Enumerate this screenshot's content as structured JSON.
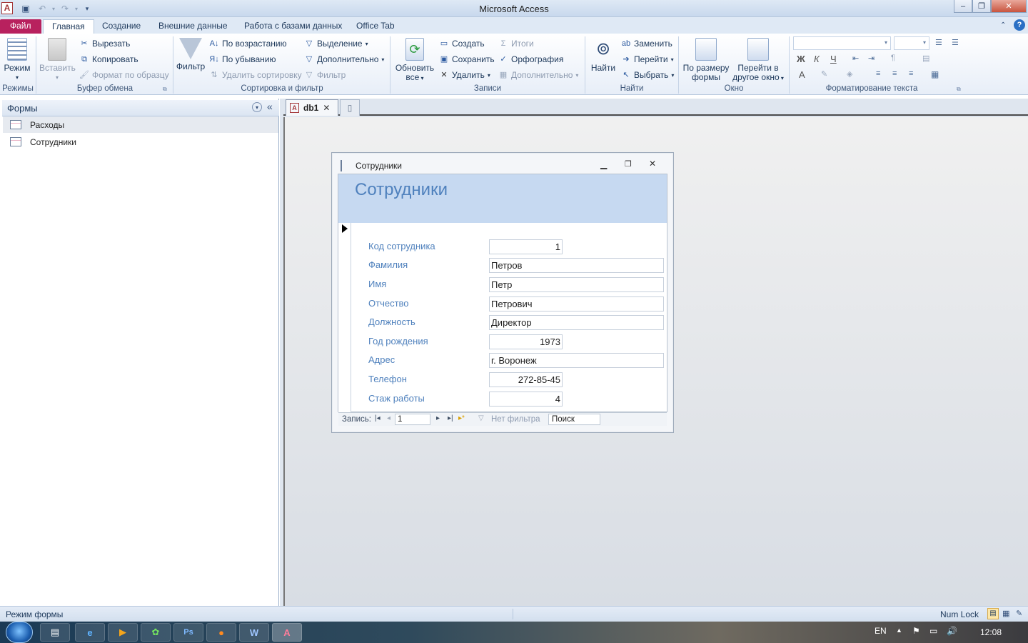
{
  "titlebar": {
    "title": "Microsoft Access"
  },
  "tabs": {
    "file": "Файл",
    "home": "Главная",
    "create": "Создание",
    "external": "Внешние данные",
    "dbtools": "Работа с базами данных",
    "officetab": "Office Tab"
  },
  "ribbon": {
    "views": {
      "mode": "Режим",
      "group": "Режимы"
    },
    "clipboard": {
      "paste": "Вставить",
      "cut": "Вырезать",
      "copy": "Копировать",
      "format_painter": "Формат по образцу",
      "group": "Буфер обмена"
    },
    "sort": {
      "filter": "Фильтр",
      "asc": "По возрастанию",
      "desc": "По убыванию",
      "remove_sort": "Удалить сортировку",
      "selection": "Выделение",
      "advanced": "Дополнительно",
      "toggle_filter": "Фильтр",
      "group": "Сортировка и фильтр"
    },
    "records": {
      "refresh_line1": "Обновить",
      "refresh_line2": "все",
      "new": "Создать",
      "save": "Сохранить",
      "delete": "Удалить",
      "totals": "Итоги",
      "spelling": "Орфография",
      "more": "Дополнительно",
      "group": "Записи"
    },
    "find": {
      "find": "Найти",
      "replace": "Заменить",
      "goto": "Перейти",
      "select": "Выбрать",
      "group": "Найти"
    },
    "window": {
      "fit_line1": "По размеру",
      "fit_line2": "формы",
      "switch_line1": "Перейти в",
      "switch_line2": "другое окно",
      "group": "Окно"
    },
    "text": {
      "bold": "Ж",
      "italic": "К",
      "underline": "Ч",
      "fontcolor": "А",
      "group": "Форматирование текста"
    }
  },
  "navpane": {
    "title": "Формы",
    "items": [
      {
        "label": "Расходы"
      },
      {
        "label": "Сотрудники"
      }
    ]
  },
  "doctabs": {
    "db1": "db1"
  },
  "form": {
    "window_title": "Сотрудники",
    "header": "Сотрудники",
    "fields": [
      {
        "label": "Код сотрудника",
        "value": "1"
      },
      {
        "label": "Фамилия",
        "value": "Петров"
      },
      {
        "label": "Имя",
        "value": "Петр"
      },
      {
        "label": "Отчество",
        "value": "Петрович"
      },
      {
        "label": "Должность",
        "value": "Директор"
      },
      {
        "label": "Год рождения",
        "value": "1973"
      },
      {
        "label": "Адрес",
        "value": "г. Воронеж"
      },
      {
        "label": "Телефон",
        "value": "272-85-45"
      },
      {
        "label": "Стаж работы",
        "value": "4"
      }
    ],
    "navbar": {
      "record_label": "Запись:",
      "current": "1",
      "no_filter": "Нет фильтра",
      "search": "Поиск"
    }
  },
  "status": {
    "mode": "Режим формы",
    "numlock": "Num Lock"
  },
  "taskbar": {
    "lang": "EN",
    "time": "12:08",
    "apps": [
      "Ps",
      "W",
      "A"
    ]
  }
}
